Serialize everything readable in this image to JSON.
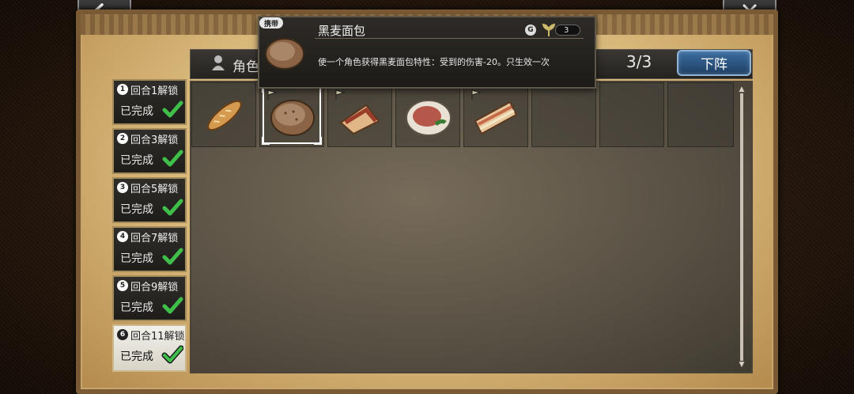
{
  "nav": {
    "back_icon": "back-arrow-icon",
    "close_icon": "close-icon"
  },
  "header": {
    "role_label": "角色",
    "count": "3/3",
    "unequip_label": "下阵"
  },
  "unlocks": [
    {
      "turn_badge": "1",
      "title": "回合1解锁",
      "status": "已完成"
    },
    {
      "turn_badge": "2",
      "title": "回合3解锁",
      "status": "已完成"
    },
    {
      "turn_badge": "3",
      "title": "回合5解锁",
      "status": "已完成"
    },
    {
      "turn_badge": "4",
      "title": "回合7解锁",
      "status": "已完成"
    },
    {
      "turn_badge": "5",
      "title": "回合9解锁",
      "status": "已完成"
    },
    {
      "turn_badge": "6",
      "title": "回合11解锁",
      "status": "已完成"
    }
  ],
  "items": [
    {
      "icon": "baguette-icon",
      "flag": false
    },
    {
      "icon": "rye-bread-icon",
      "flag": true,
      "selected": true
    },
    {
      "icon": "sandwich-slice-icon",
      "flag": true
    },
    {
      "icon": "meat-plate-icon",
      "flag": false
    },
    {
      "icon": "club-sandwich-icon",
      "flag": true
    },
    {
      "icon": "empty-slot",
      "flag": false
    },
    {
      "icon": "empty-slot",
      "flag": false
    },
    {
      "icon": "empty-slot",
      "flag": false
    }
  ],
  "tooltip": {
    "badge": "携带",
    "name": "黑麦面包",
    "g_icon": "G",
    "quantity": "3",
    "description": "使一个角色获得黑麦面包特性：受到的伤害-20。只生效一次"
  },
  "colors": {
    "accent_blue": "#3b6ea0",
    "check_green": "#3fbf4a",
    "parchment": "#d8b77a"
  }
}
